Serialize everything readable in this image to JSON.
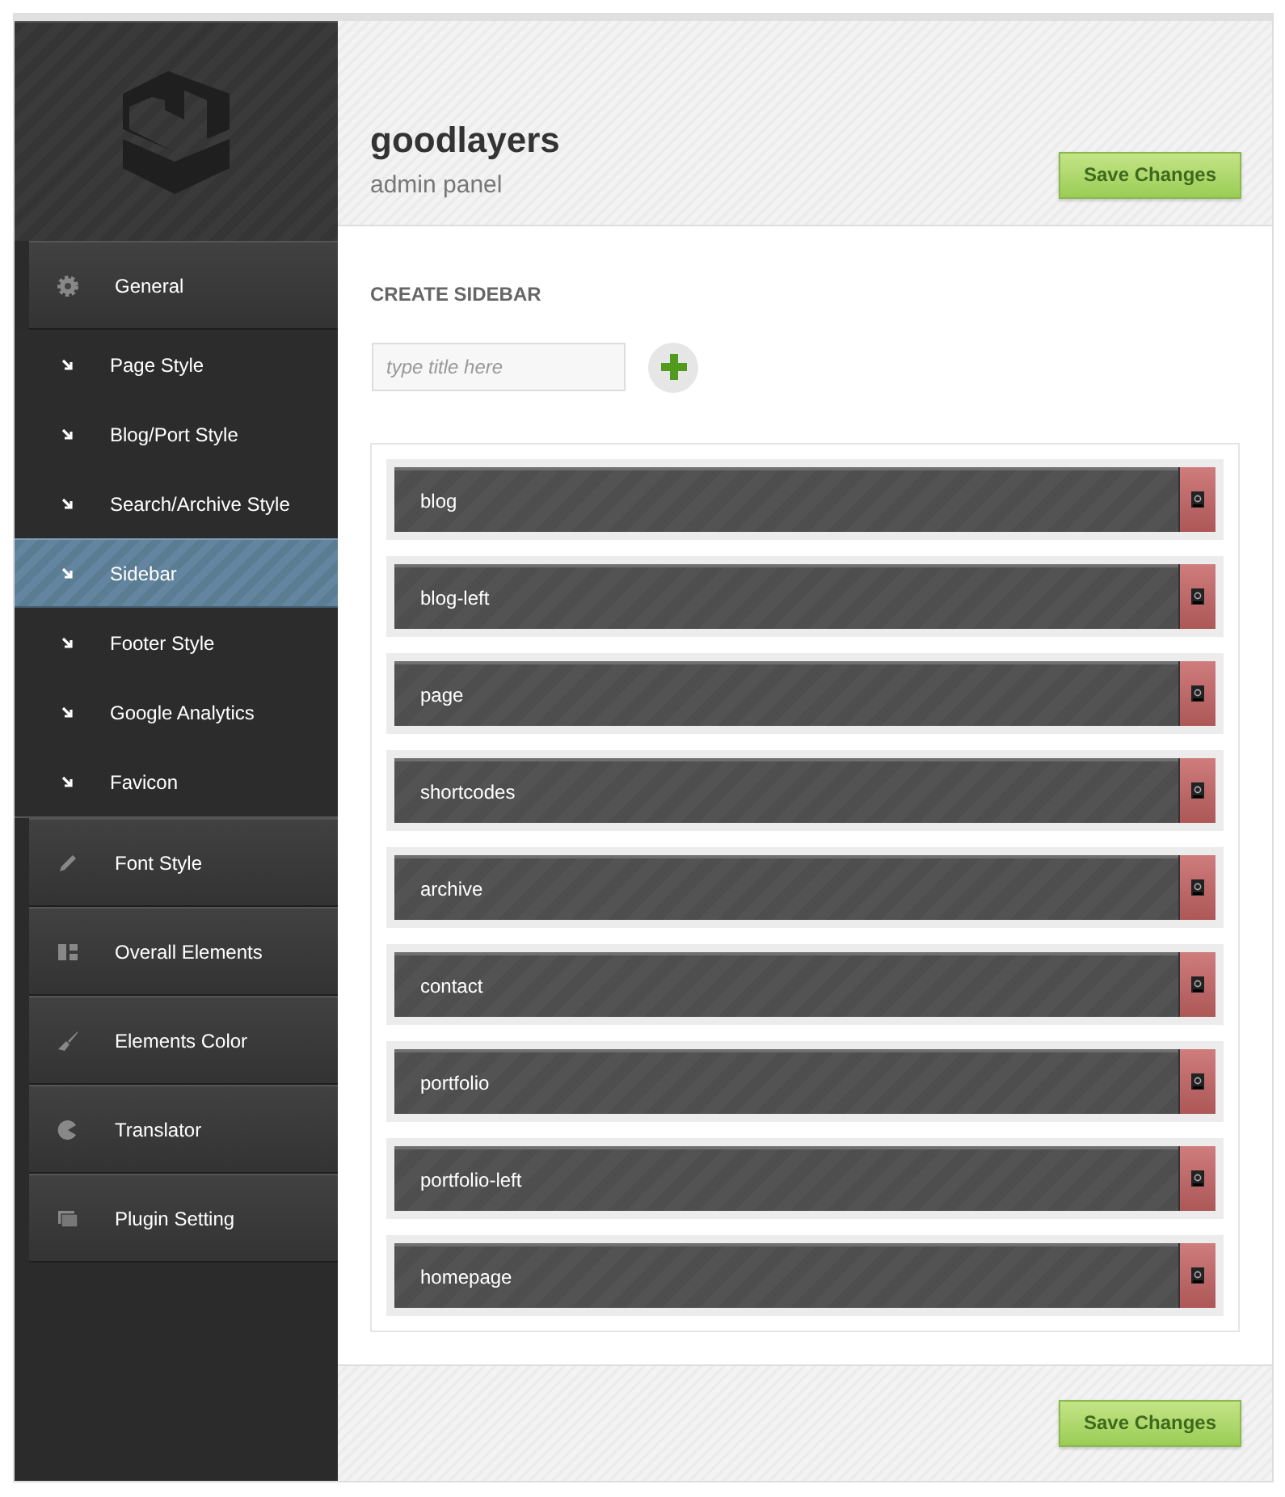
{
  "header": {
    "title": "goodlayers",
    "subtitle": "admin panel",
    "save_button": "Save Changes"
  },
  "menu": [
    {
      "label": "General",
      "selected": false,
      "children": [
        {
          "label": "Page Style",
          "selected": false
        },
        {
          "label": "Blog/Port Style",
          "selected": false
        },
        {
          "label": "Search/Archive Style",
          "selected": false
        },
        {
          "label": "Sidebar",
          "selected": true
        },
        {
          "label": "Footer Style",
          "selected": false
        },
        {
          "label": "Google Analytics",
          "selected": false
        },
        {
          "label": "Favicon",
          "selected": false
        }
      ]
    },
    {
      "label": "Font Style",
      "selected": false
    },
    {
      "label": "Overall Elements",
      "selected": false
    },
    {
      "label": "Elements Color",
      "selected": false
    },
    {
      "label": "Translator",
      "selected": false
    },
    {
      "label": "Plugin Setting",
      "selected": false
    }
  ],
  "create_sidebar": {
    "heading": "CREATE SIDEBAR",
    "placeholder": "type title here"
  },
  "sidebars": [
    "blog",
    "blog-left",
    "page",
    "shortcodes",
    "archive",
    "contact",
    "portfolio",
    "portfolio-left",
    "homepage"
  ],
  "footer": {
    "save_button": "Save Changes"
  }
}
